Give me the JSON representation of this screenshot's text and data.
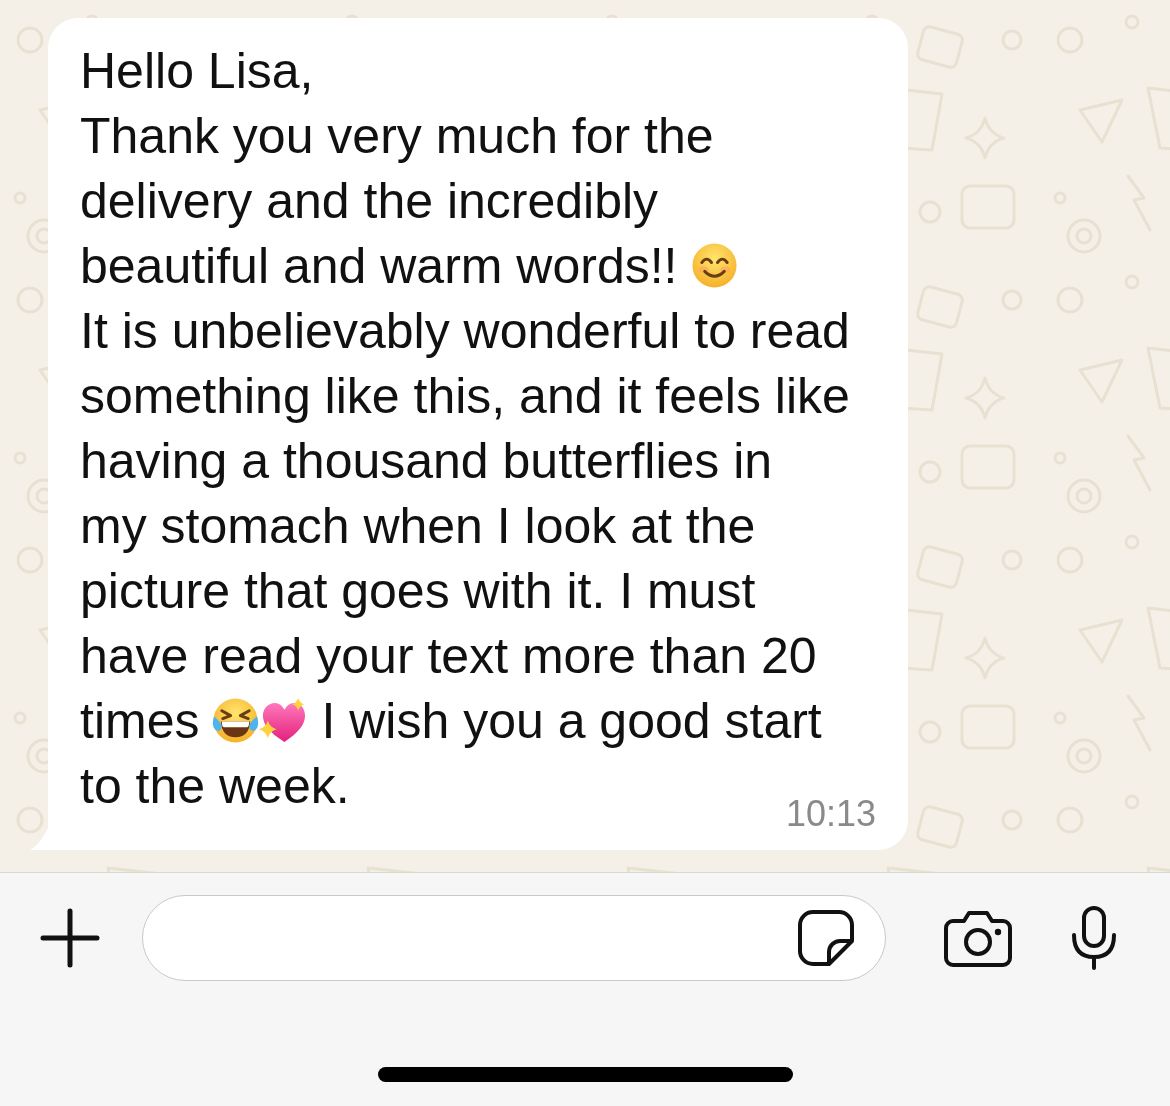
{
  "message": {
    "lines": [
      {
        "segments": [
          {
            "kind": "text",
            "text": "Hello Lisa,"
          }
        ]
      },
      {
        "segments": [
          {
            "kind": "text",
            "text": "Thank you very much for the"
          }
        ]
      },
      {
        "segments": [
          {
            "kind": "text",
            "text": "delivery and the incredibly"
          }
        ]
      },
      {
        "segments": [
          {
            "kind": "text",
            "text": "beautiful and warm words!!"
          },
          {
            "kind": "smile"
          }
        ]
      },
      {
        "segments": [
          {
            "kind": "text",
            "text": "It is unbelievably wonderful to read"
          }
        ]
      },
      {
        "segments": [
          {
            "kind": "text",
            "text": "something like this, and it feels like"
          }
        ]
      },
      {
        "segments": [
          {
            "kind": "text",
            "text": "having a thousand butterflies in"
          }
        ]
      },
      {
        "segments": [
          {
            "kind": "text",
            "text": "my stomach when I look at the"
          }
        ]
      },
      {
        "segments": [
          {
            "kind": "text",
            "text": "picture that goes with it. I must"
          }
        ]
      },
      {
        "segments": [
          {
            "kind": "text",
            "text": "have read your text more than 20"
          }
        ]
      },
      {
        "segments": [
          {
            "kind": "text",
            "text": "times"
          },
          {
            "kind": "laugh"
          },
          {
            "kind": "heart"
          },
          {
            "kind": "text",
            "text": "I wish you a good start"
          }
        ]
      },
      {
        "segments": [
          {
            "kind": "text",
            "text": "to the week."
          }
        ]
      }
    ],
    "time": "10:13"
  }
}
